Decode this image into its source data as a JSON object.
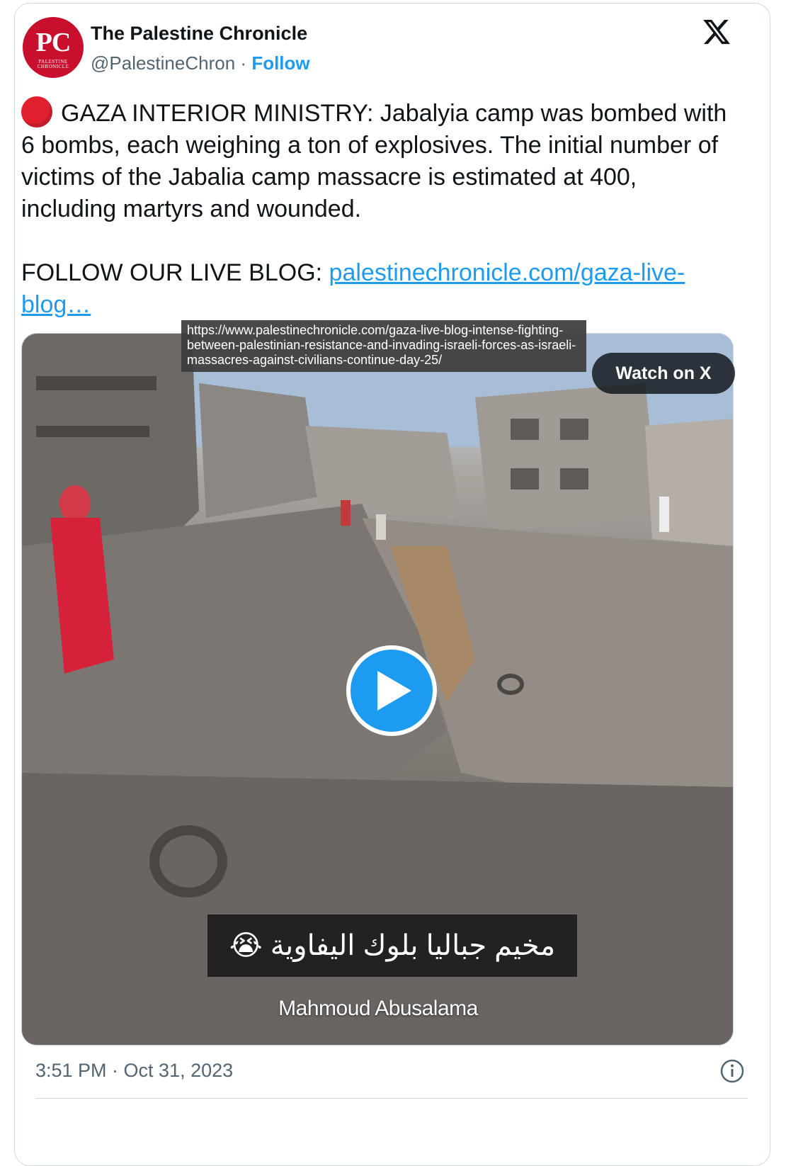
{
  "author": {
    "name": "The Palestine Chronicle",
    "handle": "@PalestineChron",
    "separator": "·",
    "follow_label": "Follow",
    "avatar_initials": "PC",
    "avatar_subtitle_line1": "PALESTINE",
    "avatar_subtitle_line2": "CHRONICLE",
    "avatar_color": "#c8102e"
  },
  "platform_icon": "x-logo-icon",
  "tweet": {
    "emoji": "red-circle-icon",
    "body": "GAZA INTERIOR MINISTRY: Jabalyia camp was bombed with 6 bombs, each weighing a ton of explosives. The initial number of victims of the Jabalia camp massacre is estimated at 400, including martyrs and wounded.",
    "follow_prefix": "FOLLOW OUR LIVE BLOG: ",
    "link_text": "palestinechronicle.com/gaza-live-blog…"
  },
  "media": {
    "tooltip_url": "https://www.palestinechronicle.com/gaza-live-blog-intense-fighting-between-palestinian-resistance-and-invading-israeli-forces-as-israeli-massacres-against-civilians-continue-day-25/",
    "watch_label": "Watch on X",
    "play_icon": "play-icon",
    "caption_arabic": "مخيم جباليا بلوك اليفاوية 😭",
    "credit": "Mahmoud Abusalama"
  },
  "footer": {
    "timestamp": "3:51 PM · Oct 31, 2023",
    "info_icon": "info-icon"
  },
  "colors": {
    "link": "#1d9bf0",
    "secondary_text": "#536471",
    "border": "#cfd9de",
    "red_dot": "#e0202e"
  }
}
